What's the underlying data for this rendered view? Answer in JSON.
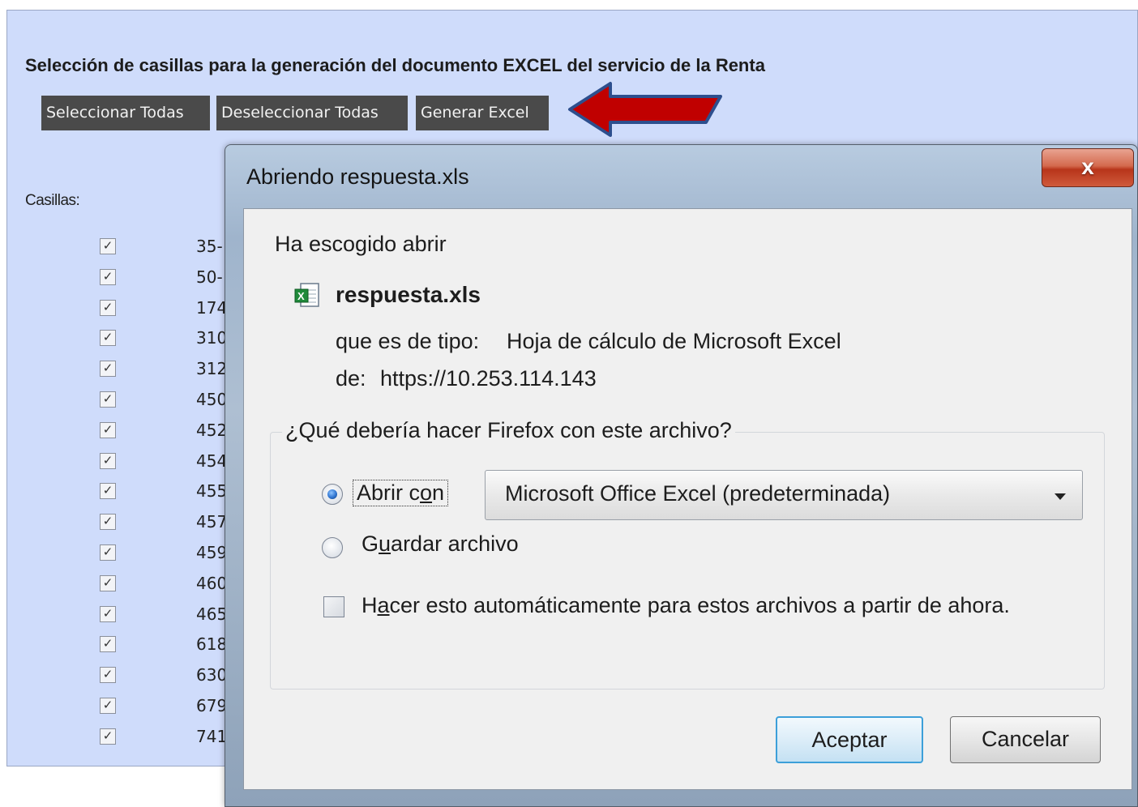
{
  "page": {
    "title": "Selección de casillas para la generación del documento EXCEL del servicio de la Renta",
    "buttons": {
      "select_all": "Seleccionar Todas",
      "deselect_all": "Deseleccionar Todas",
      "generate": "Generar Excel"
    },
    "casillas_label": "Casillas:",
    "checkbox_codes": [
      "35-",
      "50-",
      "174",
      "310",
      "312",
      "450",
      "452",
      "454",
      "455",
      "457",
      "459",
      "460",
      "465",
      "618",
      "630",
      "679",
      "741"
    ],
    "arrow_color": "#c00000"
  },
  "dialog": {
    "title": "Abriendo respuesta.xls",
    "close_label": "x",
    "chosen_text": "Ha escogido abrir",
    "filename": "respuesta.xls",
    "file_icon": "excel-file-icon",
    "type_label": "que es de tipo:",
    "type_value": "Hoja de cálculo de Microsoft Excel",
    "from_label": "de:",
    "from_value": "https://10.253.114.143",
    "question": "¿Qué debería hacer Firefox con este archivo?",
    "open_with": {
      "pre": "Abrir c",
      "u": "o",
      "post": "n"
    },
    "app_selected": "Microsoft Office Excel (predeterminada)",
    "save_file": {
      "pre": "G",
      "u": "u",
      "post": "ardar archivo"
    },
    "auto_text": {
      "pre": "H",
      "u": "a",
      "post": "cer esto automáticamente para estos archivos a partir de ahora."
    },
    "accept": "Aceptar",
    "cancel": "Cancelar"
  }
}
